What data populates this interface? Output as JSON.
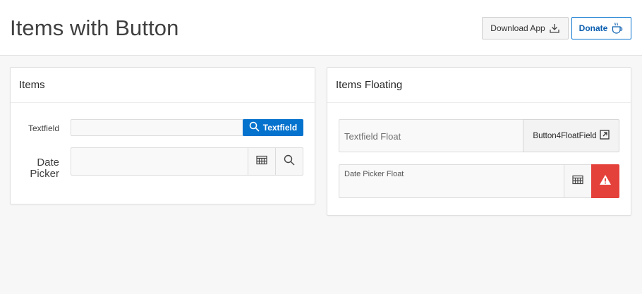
{
  "header": {
    "title": "Items with Button",
    "download_label": "Download App",
    "donate_label": "Donate"
  },
  "items_region": {
    "title": "Items",
    "textfield_label": "Textfield",
    "textfield_value": "",
    "textfield_button_label": "Textfield",
    "datepicker_label": "Date Picker",
    "datepicker_value": ""
  },
  "floating_region": {
    "title": "Items Floating",
    "textfield_float_label": "Textfield Float",
    "textfield_float_button_label": "Button4FloatField",
    "datepicker_float_label": "Date Picker Float"
  },
  "colors": {
    "primary": "#0572ce",
    "danger": "#e5413b",
    "background": "#f7f7f7"
  },
  "icons": [
    "download-icon",
    "coffee-cup-icon",
    "search-icon",
    "calendar-icon",
    "external-link-icon",
    "warning-icon"
  ]
}
